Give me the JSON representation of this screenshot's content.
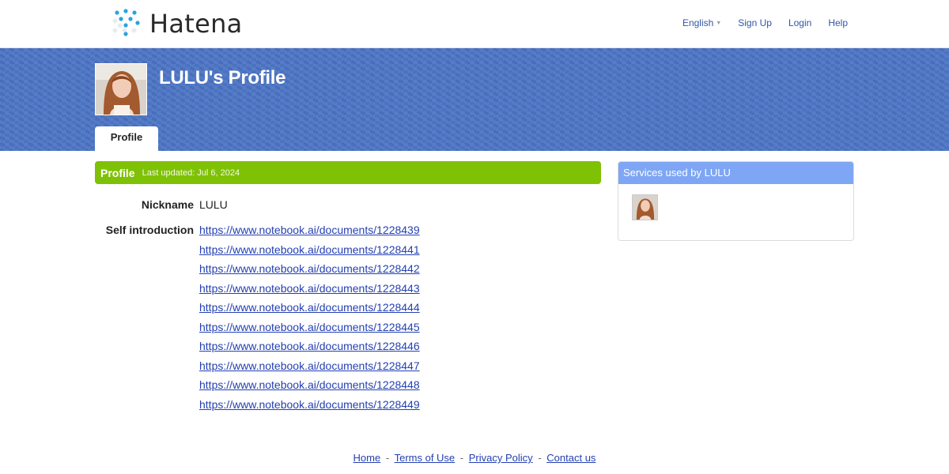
{
  "header": {
    "logo_text": "Hatena",
    "nav": {
      "language": "English",
      "signup": "Sign Up",
      "login": "Login",
      "help": "Help"
    }
  },
  "banner": {
    "title": "LULU's Profile",
    "tab_label": "Profile"
  },
  "profile": {
    "section_title": "Profile",
    "last_updated": "Last updated: Jul 6, 2024",
    "nickname_label": "Nickname",
    "nickname_value": "LULU",
    "intro_label": "Self introduction",
    "intro_links": [
      "https://www.notebook.ai/documents/1228439",
      "https://www.notebook.ai/documents/1228441",
      "https://www.notebook.ai/documents/1228442",
      "https://www.notebook.ai/documents/1228443",
      "https://www.notebook.ai/documents/1228444",
      "https://www.notebook.ai/documents/1228445",
      "https://www.notebook.ai/documents/1228446",
      "https://www.notebook.ai/documents/1228447",
      "https://www.notebook.ai/documents/1228448",
      "https://www.notebook.ai/documents/1228449"
    ]
  },
  "sidebar": {
    "title": "Services used by LULU"
  },
  "footer": {
    "home": "Home",
    "terms": "Terms of Use",
    "privacy": "Privacy Policy",
    "contact": "Contact us",
    "separator": "-"
  },
  "colors": {
    "banner_blue": "#4a73c2",
    "section_green": "#7fc105",
    "sidebar_blue": "#7ea6f5",
    "link_blue": "#2440b3",
    "logo_dot_blue": "#29a3e2"
  }
}
